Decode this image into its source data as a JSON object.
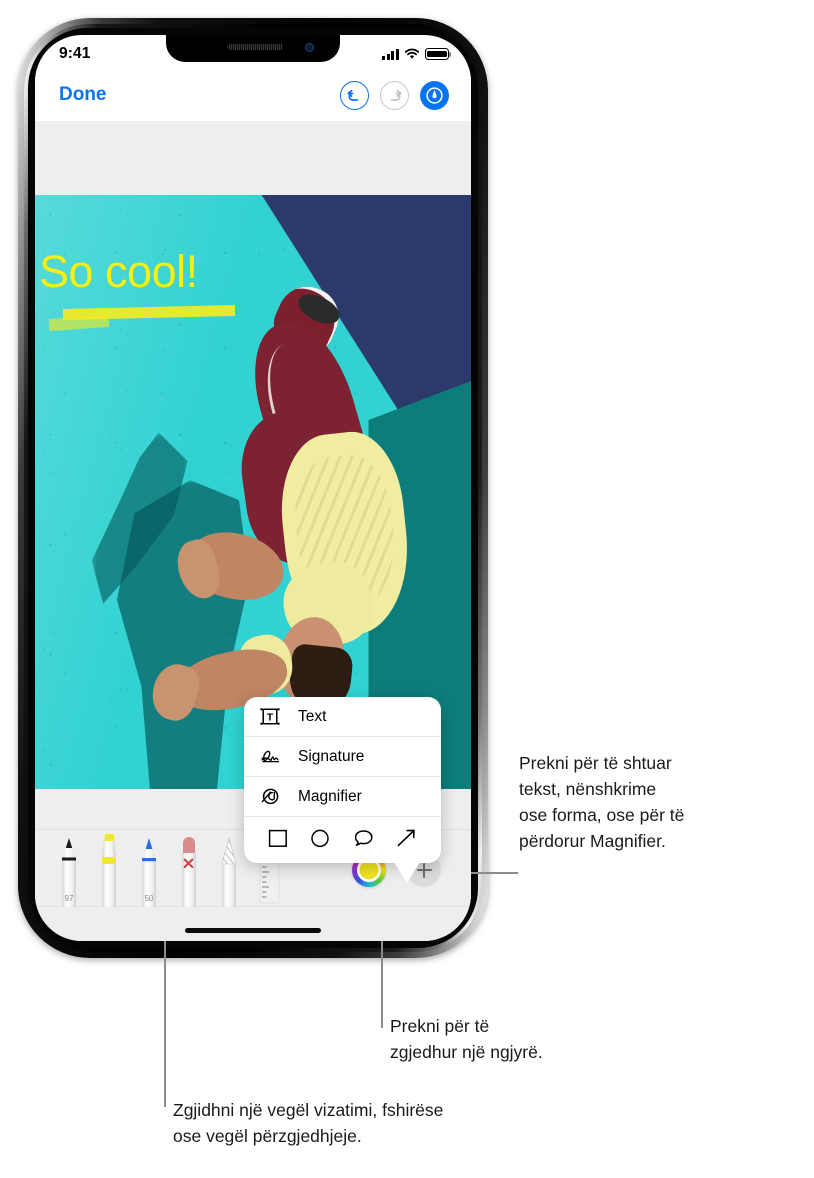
{
  "status_bar": {
    "time": "9:41",
    "signal_icon": "cellular-bars-icon",
    "wifi_icon": "wifi-icon",
    "battery_icon": "battery-full-icon"
  },
  "nav_bar": {
    "done_label": "Done",
    "undo_icon": "undo-arrow-icon",
    "redo_icon": "redo-arrow-icon",
    "markup_icon": "markup-pen-icon"
  },
  "photo": {
    "annotation_text": "So cool!",
    "annotation_color": "#F5EF18",
    "highlight_color": "#F2EC22",
    "wall_teal": "#32D2D2",
    "wall_navy": "#2B3A6B",
    "wall_dark_teal": "#0D7D7B"
  },
  "popup_menu": {
    "items": [
      {
        "label": "Text",
        "icon": "text-box-icon"
      },
      {
        "label": "Signature",
        "icon": "signature-icon"
      },
      {
        "label": "Magnifier",
        "icon": "magnifier-loupe-icon"
      }
    ],
    "shapes": [
      {
        "name": "square-shape-icon"
      },
      {
        "name": "circle-shape-icon"
      },
      {
        "name": "speech-bubble-shape-icon"
      },
      {
        "name": "arrow-shape-icon"
      }
    ]
  },
  "toolbar": {
    "tools": [
      {
        "name": "pen-tool",
        "opacity_label": "97",
        "tip_color": "#1A1A1A"
      },
      {
        "name": "highlighter-tool",
        "opacity_label": "",
        "tip_color": "#EFE833"
      },
      {
        "name": "pencil-tool",
        "opacity_label": "50",
        "tip_color": "#2A6FE0"
      },
      {
        "name": "eraser-tool",
        "opacity_label": "",
        "tip_color": "#D98A8A"
      },
      {
        "name": "lasso-selection-tool",
        "opacity_label": "",
        "tip_color": "#BFBFBF"
      },
      {
        "name": "ruler-tool",
        "opacity_label": "",
        "tip_color": "#D6D6D6"
      }
    ],
    "color_wheel": {
      "name": "color-picker-wheel",
      "selected_color": "#F2E51F"
    },
    "add_button": {
      "name": "add-annotation-button",
      "glyph": "+"
    }
  },
  "callouts": [
    {
      "id": "add-annotation-callout",
      "lines": [
        "Prekni për të shtuar",
        "tekst, nënshkrime",
        "ose forma, ose për të",
        "përdorur Magnifier."
      ]
    },
    {
      "id": "color-picker-callout",
      "lines": [
        "Prekni për të",
        "zgjedhur një ngjyrë."
      ]
    },
    {
      "id": "drawing-tools-callout",
      "lines": [
        "Zgjidhni një vegël vizatimi, fshirëse",
        "ose vegël përzgjedhjeje."
      ]
    }
  ],
  "colors": {
    "accent_blue": "#0A74F0",
    "leader_grey": "#8C8C8C",
    "toolbar_bg": "#EEEEEE"
  }
}
